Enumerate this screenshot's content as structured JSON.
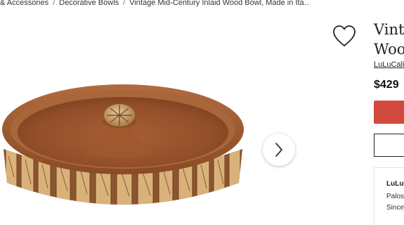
{
  "breadcrumb": {
    "items": [
      "& Accessories",
      "Decorative Bowls",
      "Vintage Mid-Century Inlaid Wood Bowl, Made in Ita…"
    ],
    "separator": "/"
  },
  "product": {
    "title_line1": "Vinta",
    "title_line2": "Woo",
    "seller_link": "LuLuCalif",
    "price": "$429"
  },
  "seller_card": {
    "name": "LuLuC",
    "location": "Palos",
    "since": "Since"
  },
  "icons": {
    "favorite": "heart-icon",
    "next": "chevron-right-icon"
  },
  "colors": {
    "primary_button": "#d14a3c",
    "bowl_wood": "#9b5a34"
  }
}
